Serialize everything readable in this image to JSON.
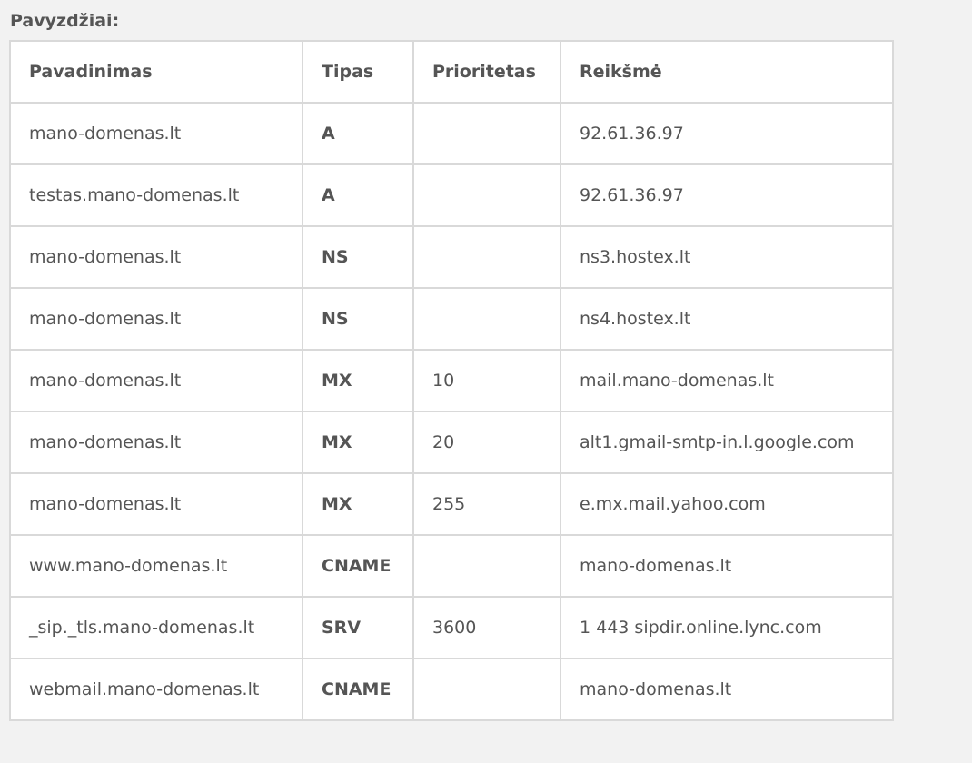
{
  "section_title": "Pavyzdžiai:",
  "table": {
    "headers": {
      "name": "Pavadinimas",
      "type": "Tipas",
      "priority": "Prioritetas",
      "value": "Reikšmė"
    },
    "rows": [
      {
        "name": "mano-domenas.lt",
        "type": "A",
        "priority": "",
        "value": "92.61.36.97"
      },
      {
        "name": "testas.mano-domenas.lt",
        "type": "A",
        "priority": "",
        "value": "92.61.36.97"
      },
      {
        "name": "mano-domenas.lt",
        "type": "NS",
        "priority": "",
        "value": "ns3.hostex.lt"
      },
      {
        "name": "mano-domenas.lt",
        "type": "NS",
        "priority": "",
        "value": "ns4.hostex.lt"
      },
      {
        "name": "mano-domenas.lt",
        "type": "MX",
        "priority": "10",
        "value": "mail.mano-domenas.lt"
      },
      {
        "name": "mano-domenas.lt",
        "type": "MX",
        "priority": "20",
        "value": "alt1.gmail-smtp-in.l.google.com"
      },
      {
        "name": "mano-domenas.lt",
        "type": "MX",
        "priority": "255",
        "value": "e.mx.mail.yahoo.com"
      },
      {
        "name": "www.mano-domenas.lt",
        "type": "CNAME",
        "priority": "",
        "value": "mano-domenas.lt"
      },
      {
        "name": "_sip._tls.mano-domenas.lt",
        "type": "SRV",
        "priority": "3600",
        "value": "1 443 sipdir.online.lync.com"
      },
      {
        "name": "webmail.mano-domenas.lt",
        "type": "CNAME",
        "priority": "",
        "value": "mano-domenas.lt"
      }
    ]
  }
}
